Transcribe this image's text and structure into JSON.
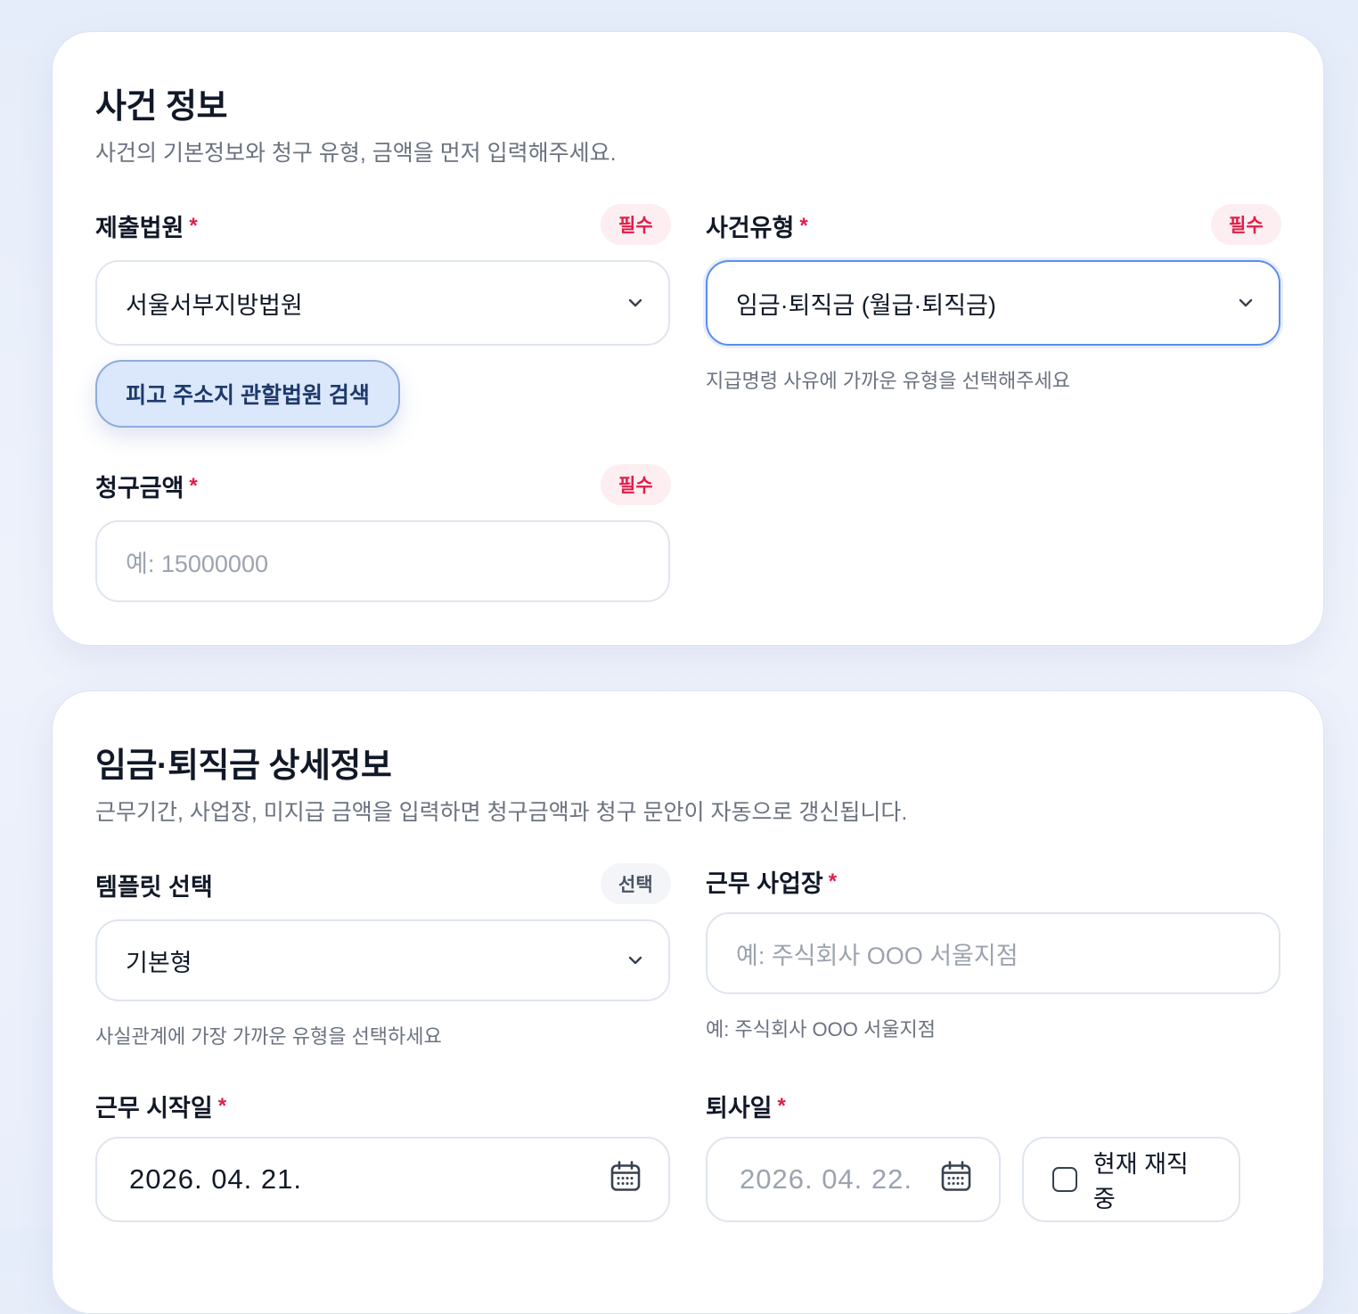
{
  "case_info": {
    "title": "사건 정보",
    "description": "사건의 기본정보와 청구 유형, 금액을 먼저 입력해주세요.",
    "court": {
      "label": "제출법원",
      "required_mark": "*",
      "badge": "필수",
      "value": "서울서부지방법원",
      "search_button": "피고 주소지 관할법원 검색"
    },
    "case_type": {
      "label": "사건유형",
      "required_mark": "*",
      "badge": "필수",
      "value": "임금·퇴직금 (월급·퇴직금)",
      "hint": "지급명령 사유에 가까운 유형을 선택해주세요"
    },
    "claim_amount": {
      "label": "청구금액",
      "required_mark": "*",
      "badge": "필수",
      "value": "",
      "placeholder": "예: 15000000"
    }
  },
  "wage_detail": {
    "title": "임금·퇴직금 상세정보",
    "description": "근무기간, 사업장, 미지급 금액을 입력하면 청구금액과 청구 문안이 자동으로 갱신됩니다.",
    "template": {
      "label": "템플릿 선택",
      "badge": "선택",
      "value": "기본형",
      "hint": "사실관계에 가장 가까운 유형을 선택하세요"
    },
    "workplace": {
      "label": "근무 사업장",
      "required_mark": "*",
      "value": "",
      "placeholder": "예: 주식회사 OOO 서울지점",
      "hint": "예: 주식회사 OOO 서울지점"
    },
    "start_date": {
      "label": "근무 시작일",
      "required_mark": "*",
      "value": "2026. 04. 21."
    },
    "end_date": {
      "label": "퇴사일",
      "required_mark": "*",
      "value": "2026. 04. 22.",
      "currently_employed_label": "현재 재직중",
      "currently_employed": false
    }
  },
  "colors": {
    "accent": "#5b8def",
    "required": "#e11d48",
    "background": "#e9eefb"
  },
  "icons": [
    "chevron-down-icon",
    "calendar-icon",
    "checkbox-icon"
  ]
}
